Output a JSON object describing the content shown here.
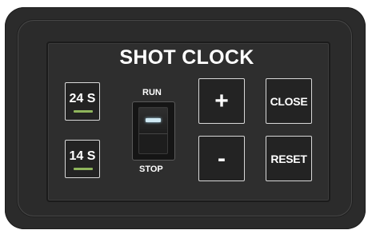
{
  "panel": {
    "title": "SHOT CLOCK"
  },
  "presets": [
    {
      "label": "24 S",
      "led_color": "#8fb55c"
    },
    {
      "label": "14 S",
      "led_color": "#8fb55c"
    }
  ],
  "switch": {
    "top_label": "RUN",
    "bottom_label": "STOP",
    "indicator_color": "#cfe9f3"
  },
  "controls": {
    "plus": "+",
    "minus": "-",
    "close": "CLOSE",
    "reset": "RESET"
  }
}
